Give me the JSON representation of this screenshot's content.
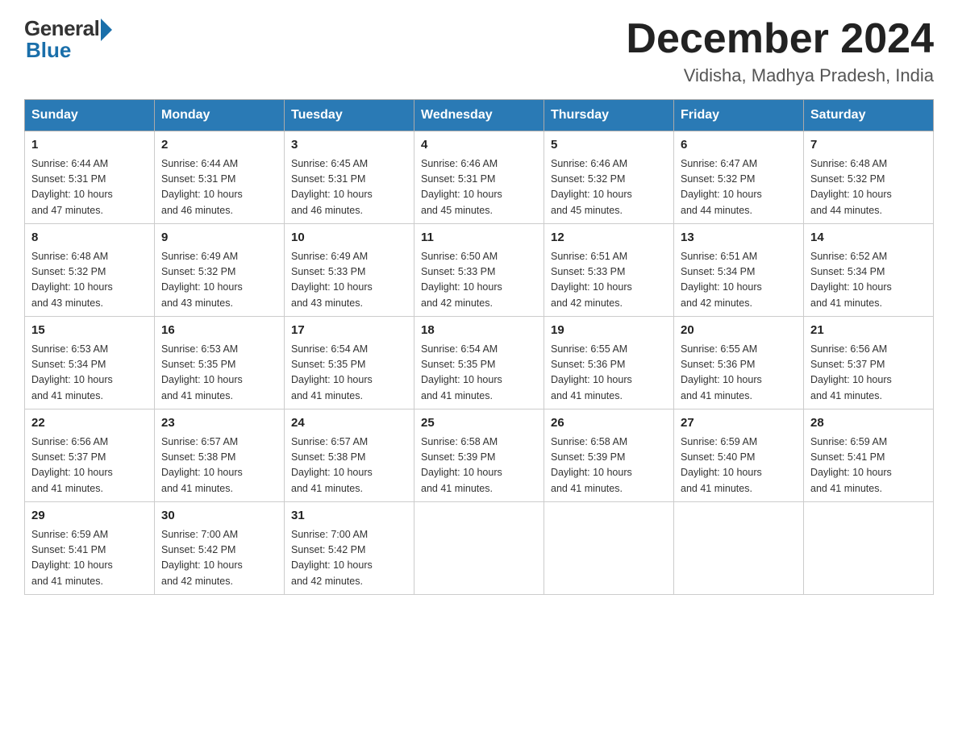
{
  "header": {
    "logo_general": "General",
    "logo_blue": "Blue",
    "month_title": "December 2024",
    "subtitle": "Vidisha, Madhya Pradesh, India"
  },
  "days_of_week": [
    "Sunday",
    "Monday",
    "Tuesday",
    "Wednesday",
    "Thursday",
    "Friday",
    "Saturday"
  ],
  "weeks": [
    [
      {
        "day": "1",
        "sunrise": "6:44 AM",
        "sunset": "5:31 PM",
        "daylight": "10 hours and 47 minutes."
      },
      {
        "day": "2",
        "sunrise": "6:44 AM",
        "sunset": "5:31 PM",
        "daylight": "10 hours and 46 minutes."
      },
      {
        "day": "3",
        "sunrise": "6:45 AM",
        "sunset": "5:31 PM",
        "daylight": "10 hours and 46 minutes."
      },
      {
        "day": "4",
        "sunrise": "6:46 AM",
        "sunset": "5:31 PM",
        "daylight": "10 hours and 45 minutes."
      },
      {
        "day": "5",
        "sunrise": "6:46 AM",
        "sunset": "5:32 PM",
        "daylight": "10 hours and 45 minutes."
      },
      {
        "day": "6",
        "sunrise": "6:47 AM",
        "sunset": "5:32 PM",
        "daylight": "10 hours and 44 minutes."
      },
      {
        "day": "7",
        "sunrise": "6:48 AM",
        "sunset": "5:32 PM",
        "daylight": "10 hours and 44 minutes."
      }
    ],
    [
      {
        "day": "8",
        "sunrise": "6:48 AM",
        "sunset": "5:32 PM",
        "daylight": "10 hours and 43 minutes."
      },
      {
        "day": "9",
        "sunrise": "6:49 AM",
        "sunset": "5:32 PM",
        "daylight": "10 hours and 43 minutes."
      },
      {
        "day": "10",
        "sunrise": "6:49 AM",
        "sunset": "5:33 PM",
        "daylight": "10 hours and 43 minutes."
      },
      {
        "day": "11",
        "sunrise": "6:50 AM",
        "sunset": "5:33 PM",
        "daylight": "10 hours and 42 minutes."
      },
      {
        "day": "12",
        "sunrise": "6:51 AM",
        "sunset": "5:33 PM",
        "daylight": "10 hours and 42 minutes."
      },
      {
        "day": "13",
        "sunrise": "6:51 AM",
        "sunset": "5:34 PM",
        "daylight": "10 hours and 42 minutes."
      },
      {
        "day": "14",
        "sunrise": "6:52 AM",
        "sunset": "5:34 PM",
        "daylight": "10 hours and 41 minutes."
      }
    ],
    [
      {
        "day": "15",
        "sunrise": "6:53 AM",
        "sunset": "5:34 PM",
        "daylight": "10 hours and 41 minutes."
      },
      {
        "day": "16",
        "sunrise": "6:53 AM",
        "sunset": "5:35 PM",
        "daylight": "10 hours and 41 minutes."
      },
      {
        "day": "17",
        "sunrise": "6:54 AM",
        "sunset": "5:35 PM",
        "daylight": "10 hours and 41 minutes."
      },
      {
        "day": "18",
        "sunrise": "6:54 AM",
        "sunset": "5:35 PM",
        "daylight": "10 hours and 41 minutes."
      },
      {
        "day": "19",
        "sunrise": "6:55 AM",
        "sunset": "5:36 PM",
        "daylight": "10 hours and 41 minutes."
      },
      {
        "day": "20",
        "sunrise": "6:55 AM",
        "sunset": "5:36 PM",
        "daylight": "10 hours and 41 minutes."
      },
      {
        "day": "21",
        "sunrise": "6:56 AM",
        "sunset": "5:37 PM",
        "daylight": "10 hours and 41 minutes."
      }
    ],
    [
      {
        "day": "22",
        "sunrise": "6:56 AM",
        "sunset": "5:37 PM",
        "daylight": "10 hours and 41 minutes."
      },
      {
        "day": "23",
        "sunrise": "6:57 AM",
        "sunset": "5:38 PM",
        "daylight": "10 hours and 41 minutes."
      },
      {
        "day": "24",
        "sunrise": "6:57 AM",
        "sunset": "5:38 PM",
        "daylight": "10 hours and 41 minutes."
      },
      {
        "day": "25",
        "sunrise": "6:58 AM",
        "sunset": "5:39 PM",
        "daylight": "10 hours and 41 minutes."
      },
      {
        "day": "26",
        "sunrise": "6:58 AM",
        "sunset": "5:39 PM",
        "daylight": "10 hours and 41 minutes."
      },
      {
        "day": "27",
        "sunrise": "6:59 AM",
        "sunset": "5:40 PM",
        "daylight": "10 hours and 41 minutes."
      },
      {
        "day": "28",
        "sunrise": "6:59 AM",
        "sunset": "5:41 PM",
        "daylight": "10 hours and 41 minutes."
      }
    ],
    [
      {
        "day": "29",
        "sunrise": "6:59 AM",
        "sunset": "5:41 PM",
        "daylight": "10 hours and 41 minutes."
      },
      {
        "day": "30",
        "sunrise": "7:00 AM",
        "sunset": "5:42 PM",
        "daylight": "10 hours and 42 minutes."
      },
      {
        "day": "31",
        "sunrise": "7:00 AM",
        "sunset": "5:42 PM",
        "daylight": "10 hours and 42 minutes."
      },
      null,
      null,
      null,
      null
    ]
  ],
  "labels": {
    "sunrise": "Sunrise:",
    "sunset": "Sunset:",
    "daylight": "Daylight:"
  }
}
